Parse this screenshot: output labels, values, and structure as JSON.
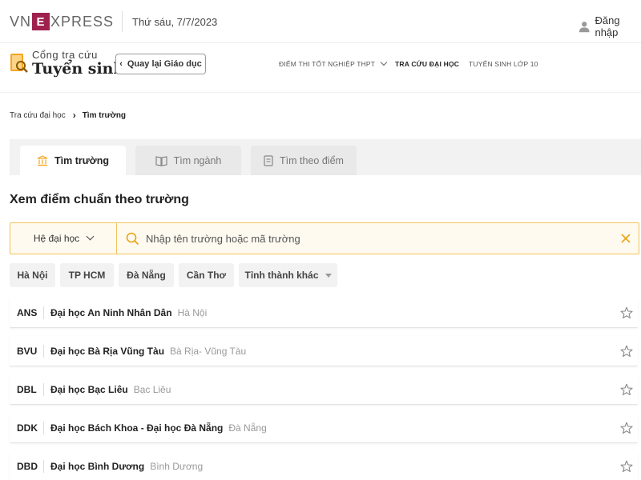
{
  "header": {
    "logo": {
      "vn": "VN",
      "e": "E",
      "xpress": "XPRESS"
    },
    "date": "Thứ sáu, 7/7/2023",
    "login_label": "Đăng nhập"
  },
  "subnav": {
    "brand_line1": "Cổng tra cứu",
    "brand_line2": "Tuyển sinh",
    "back_label": "Quay lại Giáo dục",
    "menu": [
      {
        "label": "ĐIỂM THI TỐT NGHIỆP THPT",
        "has_dropdown": true,
        "active": false
      },
      {
        "label": "TRA CỨU ĐẠI HỌC",
        "has_dropdown": false,
        "active": true
      },
      {
        "label": "TUYỂN SINH LỚP 10",
        "has_dropdown": false,
        "active": false
      }
    ]
  },
  "breadcrumb": {
    "parent": "Tra cứu đại học",
    "current": "Tìm trường"
  },
  "tabs": [
    {
      "label": "Tìm trường",
      "icon": "school-icon",
      "active": true
    },
    {
      "label": "Tìm ngành",
      "icon": "book-icon",
      "active": false
    },
    {
      "label": "Tìm theo điểm",
      "icon": "document-icon",
      "active": false
    }
  ],
  "section_title": "Xem điểm chuẩn theo trường",
  "search": {
    "level_select": "Hệ đại học",
    "placeholder": "Nhập tên trường hoặc mã trường"
  },
  "regions": [
    "Hà Nội",
    "TP HCM",
    "Đà Nẵng",
    "Cần Thơ",
    "Tỉnh thành khác"
  ],
  "schools": [
    {
      "code": "ANS",
      "name": "Đại học An Ninh Nhân Dân",
      "location": "Hà Nội"
    },
    {
      "code": "BVU",
      "name": "Đại học Bà Rịa Vũng Tàu",
      "location": "Bà Rịa- Vũng Tàu"
    },
    {
      "code": "DBL",
      "name": "Đại học Bạc Liêu",
      "location": "Bạc Liêu"
    },
    {
      "code": "DDK",
      "name": "Đại học Bách Khoa - Đại học Đà Nẵng",
      "location": "Đà Nẵng"
    },
    {
      "code": "DBD",
      "name": "Đại học Bình Dương",
      "location": "Bình Dương"
    }
  ],
  "colors": {
    "brand": "#9f224e",
    "accent_yellow": "#f0c35c",
    "search_bg": "#fffaf0",
    "tab_bg": "#f2f2f2"
  }
}
